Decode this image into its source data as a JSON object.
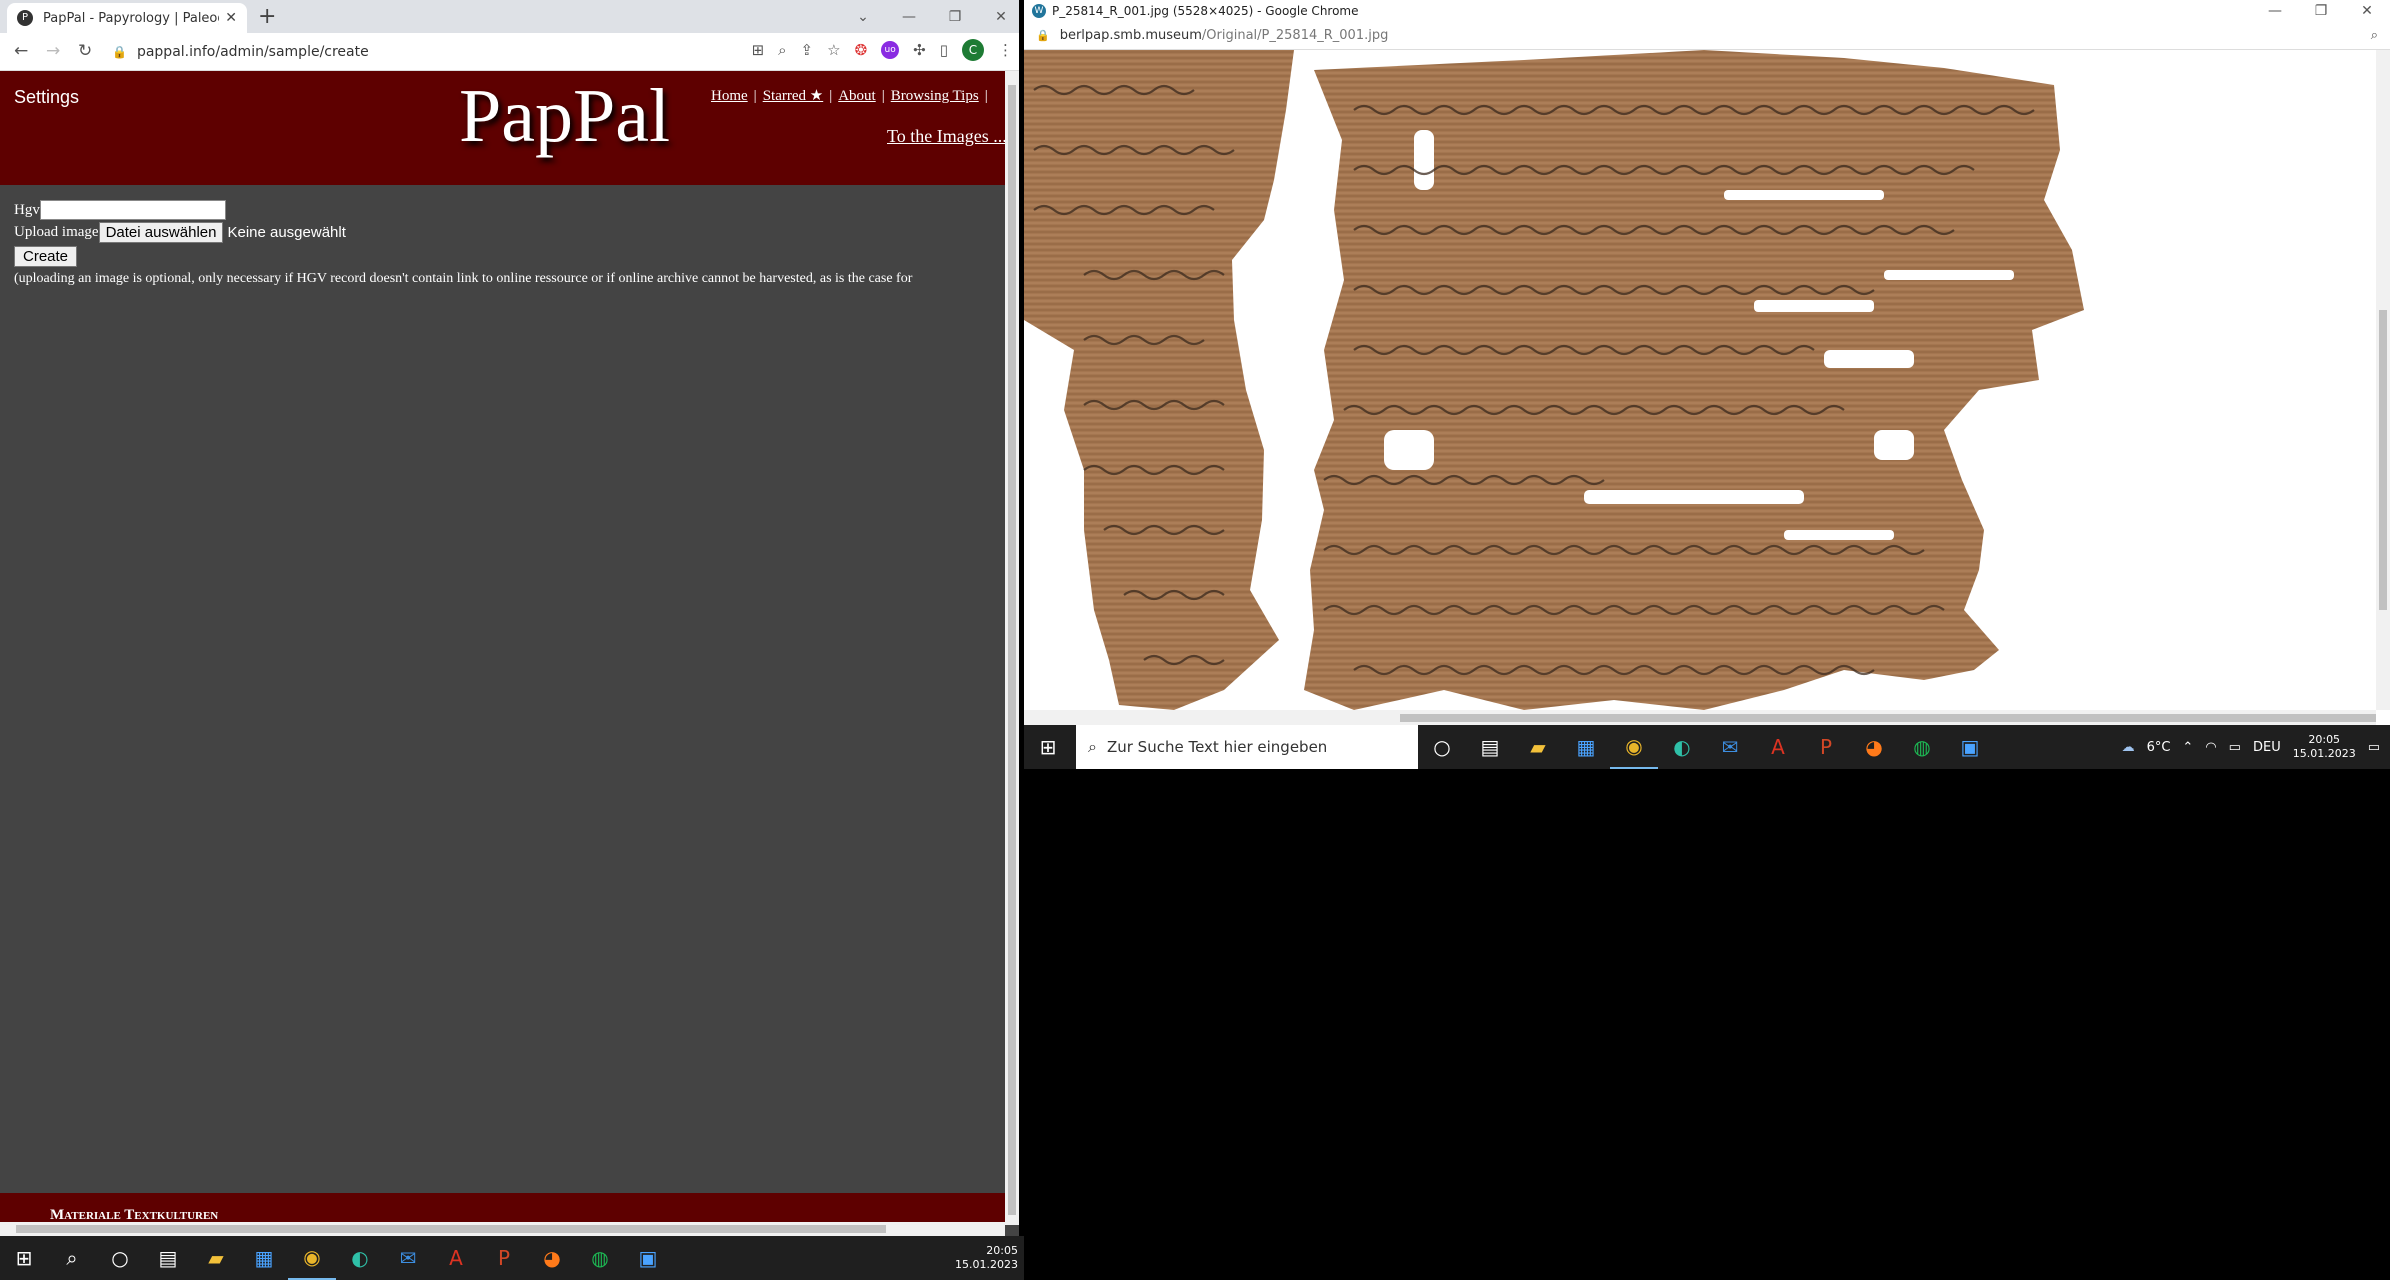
{
  "left_window": {
    "tab_title": "PapPal - Papyrology | Paleograph",
    "tab_favicon": "P",
    "url": "pappal.info/admin/sample/create",
    "profile_letter": "C"
  },
  "page": {
    "settings": "Settings",
    "logo": "PapPal",
    "nav": [
      "Home",
      "Starred ★",
      "About",
      "Browsing Tips"
    ],
    "to_images": "To the Images ...",
    "hgv_label": "Hgv",
    "upload_label": "Upload image",
    "file_button": "Datei auswählen",
    "no_file": "Keine ausgewählt",
    "create_button": "Create",
    "note": "(uploading an image is optional, only necessary if HGV record doesn't contain link to online ressource or if online archive cannot be harvested, as is the case for",
    "footer": "Materiale Textkulturen"
  },
  "right_window": {
    "title": "P_25814_R_001.jpg (5528×4025) - Google Chrome",
    "url_host": "berlpap.smb.museum",
    "url_path": "/Original/P_25814_R_001.jpg"
  },
  "taskbar_left": {
    "time": "20:05",
    "date": "15.01.2023"
  },
  "taskbar_right": {
    "search_placeholder": "Zur Suche Text hier eingeben",
    "weather": "6°C",
    "lang": "DEU",
    "time": "20:05",
    "date": "15.01.2023"
  },
  "colors": {
    "header_red": "#5e0000",
    "page_bg": "#444444"
  }
}
